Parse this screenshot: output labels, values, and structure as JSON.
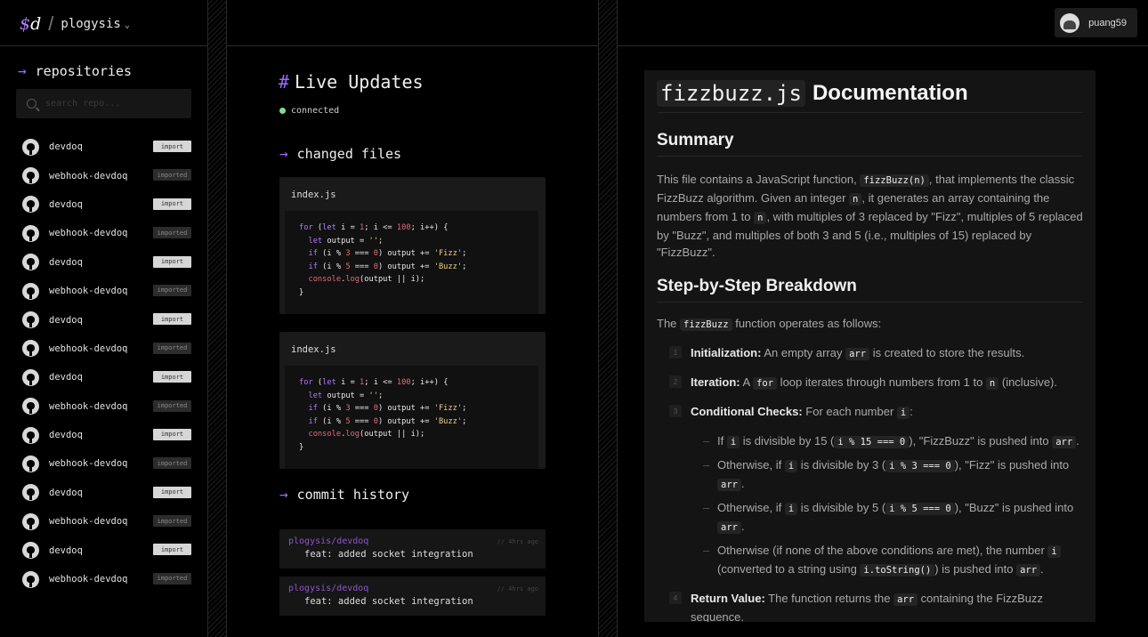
{
  "brand": {
    "logo_dollar": "$",
    "logo_d": "d",
    "org": "plogysis"
  },
  "user": {
    "name": "puang59"
  },
  "sidebar": {
    "heading": "repositories",
    "search_placeholder": "search repo...",
    "repos": [
      {
        "name": "devdoq",
        "action": "import",
        "status": "import"
      },
      {
        "name": "webhook-devdoq",
        "action": "imported",
        "status": "imported"
      },
      {
        "name": "devdoq",
        "action": "import",
        "status": "import"
      },
      {
        "name": "webhook-devdoq",
        "action": "imported",
        "status": "imported"
      },
      {
        "name": "devdoq",
        "action": "import",
        "status": "import"
      },
      {
        "name": "webhook-devdoq",
        "action": "imported",
        "status": "imported"
      },
      {
        "name": "devdoq",
        "action": "import",
        "status": "import"
      },
      {
        "name": "webhook-devdoq",
        "action": "imported",
        "status": "imported"
      },
      {
        "name": "devdoq",
        "action": "import",
        "status": "import"
      },
      {
        "name": "webhook-devdoq",
        "action": "imported",
        "status": "imported"
      },
      {
        "name": "devdoq",
        "action": "import",
        "status": "import"
      },
      {
        "name": "webhook-devdoq",
        "action": "imported",
        "status": "imported"
      },
      {
        "name": "devdoq",
        "action": "import",
        "status": "import"
      },
      {
        "name": "webhook-devdoq",
        "action": "imported",
        "status": "imported"
      },
      {
        "name": "devdoq",
        "action": "import",
        "status": "import"
      },
      {
        "name": "webhook-devdoq",
        "action": "imported",
        "status": "imported"
      }
    ]
  },
  "live": {
    "hash": "#",
    "title": "Live Updates",
    "status": "connected",
    "changed_heading": "changed files",
    "files": [
      {
        "name": "index.js"
      },
      {
        "name": "index.js"
      }
    ],
    "commit_heading": "commit history",
    "commits": [
      {
        "repo": "plogysis/devdoq",
        "time": "// 4hrs ago",
        "message": "feat: added socket integration"
      },
      {
        "repo": "plogysis/devdoq",
        "time": "// 4hrs ago",
        "message": "feat: added socket integration"
      }
    ]
  },
  "doc": {
    "file": "fizzbuzz.js",
    "title_word": "Documentation",
    "summary_heading": "Summary",
    "summary": {
      "t1": "This file contains a JavaScript function, ",
      "c1": "fizzBuzz(n)",
      "t2": ", that implements the classic FizzBuzz algorithm. Given an integer ",
      "c2": "n",
      "t3": ", it generates an array containing the numbers from 1 to ",
      "c3": "n",
      "t4": ", with multiples of 3 replaced by \"Fizz\", multiples of 5 replaced by \"Buzz\", and multiples of both 3 and 5 (i.e., multiples of 15) replaced by \"FizzBuzz\"."
    },
    "steps_heading": "Step-by-Step Breakdown",
    "intro": {
      "t1": "The ",
      "c1": "fizzBuzz",
      "t2": " function operates as follows:"
    },
    "steps": {
      "s1": {
        "num": "1",
        "label": "Initialization:",
        "t1": " An empty array ",
        "c1": "arr",
        "t2": " is created to store the results."
      },
      "s2": {
        "num": "2",
        "label": "Iteration:",
        "t1": " A ",
        "c1": "for",
        "t2": " loop iterates through numbers from 1 to ",
        "c2": "n",
        "t3": " (inclusive)."
      },
      "s3": {
        "num": "3",
        "label": "Conditional Checks:",
        "t1": " For each number ",
        "c1": "i",
        "t2": ":"
      },
      "s4": {
        "num": "4",
        "label": "Return Value:",
        "t1": " The function returns the ",
        "c1": "arr",
        "t2": " containing the FizzBuzz sequence."
      }
    },
    "subs": {
      "a": {
        "t1": "If ",
        "c1": "i",
        "t2": " is divisible by 15 (",
        "c2": "i % 15 === 0",
        "t3": "), \"FizzBuzz\" is pushed into ",
        "c3": "arr",
        "t4": "."
      },
      "b": {
        "t1": "Otherwise, if ",
        "c1": "i",
        "t2": " is divisible by 3 (",
        "c2": "i % 3 === 0",
        "t3": "), \"Fizz\" is pushed into ",
        "c3": "arr",
        "t4": "."
      },
      "c": {
        "t1": "Otherwise, if ",
        "c1": "i",
        "t2": " is divisible by 5 (",
        "c2": "i % 5 === 0",
        "t3": "), \"Buzz\" is pushed into ",
        "c3": "arr",
        "t4": "."
      },
      "d": {
        "t1": "Otherwise (if none of the above conditions are met), the number ",
        "c1": "i",
        "t2": " (converted to a string using ",
        "c2": "i.toString()",
        "t3": ") is pushed into ",
        "c3": "arr",
        "t4": "."
      }
    }
  },
  "colors": {
    "accent": "#9b6bff",
    "connected": "#7fe08a",
    "background": "#000000",
    "panel": "#141414"
  }
}
